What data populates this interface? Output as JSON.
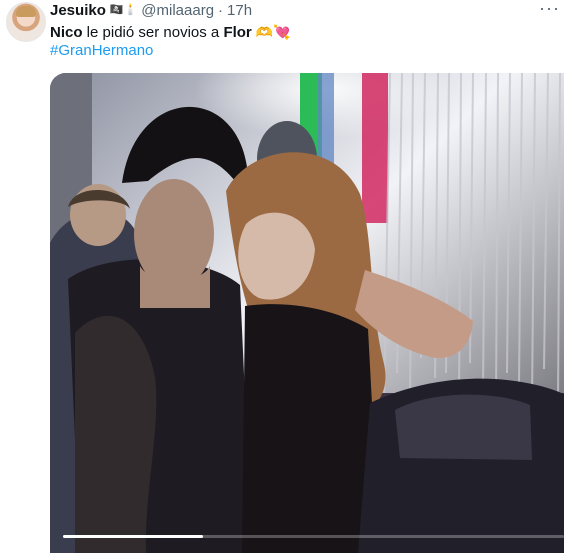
{
  "tweet": {
    "author_name": "Jesuiko",
    "author_badges": "🏴‍☠️🕯️",
    "handle": "@milaaarg",
    "separator": "·",
    "time": "17h",
    "more_label": "···",
    "text_parts": {
      "bold_1": "Nico",
      "plain_1": " le pidió ser novios a ",
      "bold_2": "Flor",
      "emoji": " 🫶💘"
    },
    "hashtag": "#GranHermano"
  },
  "video": {
    "progress_fraction": 0.28
  },
  "colors": {
    "text_primary": "#0f1419",
    "text_secondary": "#536471",
    "link": "#1d9bf0"
  },
  "icons": {
    "more": "more-horizontal-icon",
    "avatar": "profile-avatar"
  }
}
